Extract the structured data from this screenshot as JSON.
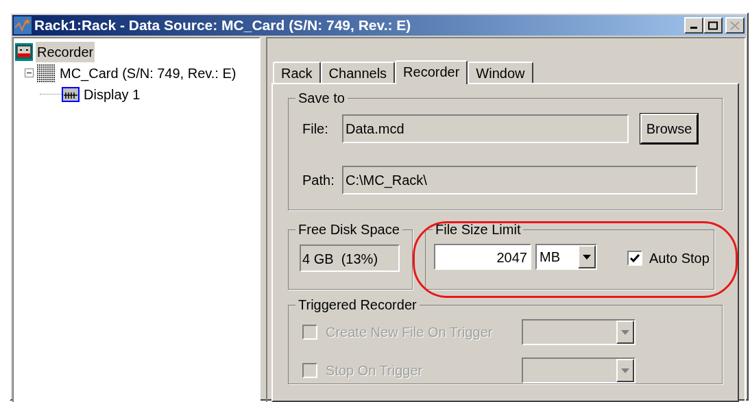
{
  "window": {
    "title": "Rack1:Rack - Data Source: MC_Card (S/N: 749, Rev.: E)"
  },
  "tree": [
    {
      "label": "Recorder",
      "kind": "recorder",
      "selected": true
    },
    {
      "label": "MC_Card (S/N: 749, Rev.: E)",
      "kind": "card",
      "selected": false,
      "expanded": true,
      "children": [
        {
          "label": "Display 1",
          "kind": "display",
          "selected": false
        }
      ]
    }
  ],
  "tabs": [
    {
      "label": "Rack",
      "selected": false
    },
    {
      "label": "Channels",
      "selected": false
    },
    {
      "label": "Recorder",
      "selected": true
    },
    {
      "label": "Window",
      "selected": false
    }
  ],
  "save_to": {
    "title": "Save to",
    "file": {
      "label": "File:",
      "value": "Data.mcd"
    },
    "browse": "Browse",
    "path": {
      "label": "Path:",
      "value": "C:\\MC_Rack\\"
    }
  },
  "free_disk_space": {
    "title": "Free Disk Space",
    "value": "4 GB  (13%)"
  },
  "file_size_limit": {
    "title": "File Size Limit",
    "value": "2047",
    "unit": "MB",
    "auto_stop": {
      "label": "Auto Stop",
      "checked": true
    }
  },
  "triggered_recorder": {
    "title": "Triggered Recorder",
    "options": [
      {
        "label": "Create New File On Trigger",
        "checked": false,
        "disabled": true
      },
      {
        "label": "Stop On Trigger",
        "checked": false,
        "disabled": true
      }
    ]
  }
}
